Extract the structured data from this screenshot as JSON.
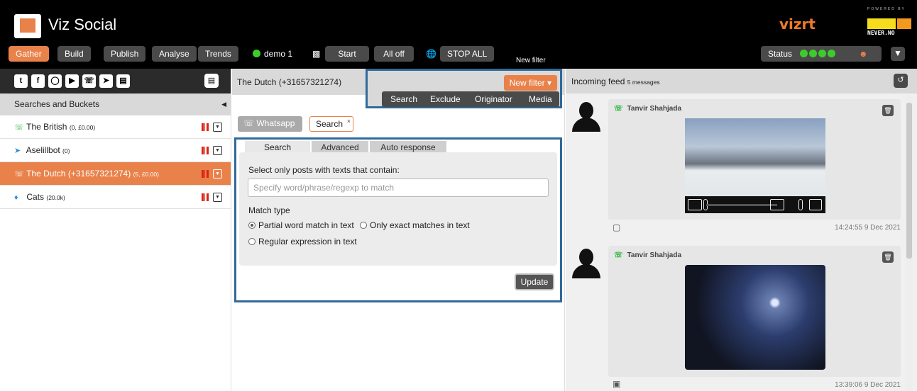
{
  "app": {
    "title": "Viz Social",
    "vendor_logo": "vizrt",
    "powered_by": "POWERED BY",
    "partner_logo": "NEVER.NO"
  },
  "nav": {
    "tabs": [
      "Gather",
      "Build",
      "Publish",
      "Analyse",
      "Trends"
    ],
    "active_tab": "Gather",
    "demo_label": "demo 1",
    "start_label": "Start",
    "all_off_label": "All off",
    "stop_all_label": "STOP ALL",
    "new_filter_caption": "New filter",
    "status_label": "Status",
    "status_color": "#3ccc2c",
    "accent_color": "#e8824a"
  },
  "sidebar": {
    "social_icons": [
      "twitter-icon",
      "facebook-icon",
      "instagram-icon",
      "youtube-icon",
      "whatsapp-icon",
      "telegram-icon",
      "rss-icon"
    ],
    "header": "Searches and Buckets",
    "items": [
      {
        "label": "The British",
        "meta": "(0, £0.00)",
        "icon": "whatsapp-icon"
      },
      {
        "label": "Aselillbot",
        "meta": "(0)",
        "icon": "telegram-icon"
      },
      {
        "label": "The Dutch (+31657321274)",
        "meta": "(5, £0.00)",
        "icon": "whatsapp-icon",
        "selected": true
      },
      {
        "label": "Cats",
        "meta": "(20.0k)",
        "icon": "twitter-icon"
      }
    ]
  },
  "middle": {
    "title": "The Dutch (+31657321274)",
    "new_filter_button": "New filter",
    "filter_tabs": [
      "Search",
      "Exclude",
      "Originator",
      "Media"
    ],
    "tags": [
      "Whatsapp",
      "Search"
    ],
    "panel_tabs": [
      "Search",
      "Advanced",
      "Auto response"
    ],
    "instruction": "Select only posts with texts that contain:",
    "input_placeholder": "Specify word/phrase/regexp to match",
    "input_value": "",
    "match_type_label": "Match type",
    "match_options": [
      "Partial word match in text",
      "Only exact matches in text",
      "Regular expression in text"
    ],
    "selected_match": "Partial word match in text",
    "update_button": "Update"
  },
  "feed": {
    "title": "Incoming feed",
    "count": "5 messages",
    "posts": [
      {
        "author": "Tanvir Shahjada",
        "media": "video-icon",
        "timestamp": "14:24:55 9 Dec 2021"
      },
      {
        "author": "Tanvir Shahjada",
        "media": "image-icon",
        "timestamp": "13:39:06 9 Dec 2021"
      }
    ]
  }
}
